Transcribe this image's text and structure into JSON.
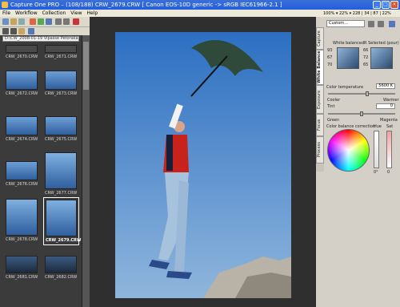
{
  "window": {
    "title": "Capture One PRO  –  (108/188) CRW_2679.CRW  [ Canon EOS-10D generic -> sRGB IEC61966-2.1 ]"
  },
  "menu": [
    "File",
    "Workflow",
    "Collection",
    "View",
    "Help"
  ],
  "toolbar": {
    "zoom_value": "",
    "status_readout": "100% ▾ 22% ▾ 228 | 34 | 87 | 22%"
  },
  "browser": {
    "folder": "D:\\CW_2008-01-19 Vipasse Petoraka",
    "thumbnails": [
      {
        "label": "CRW_2670.CRW",
        "selected": false
      },
      {
        "label": "CRW_2671.CRW",
        "selected": false
      },
      {
        "label": "CRW_2672.CRW",
        "selected": false
      },
      {
        "label": "CRW_2673.CRW",
        "selected": false
      },
      {
        "label": "CRW_2674.CRW",
        "selected": false
      },
      {
        "label": "CRW_2675.CRW",
        "selected": false
      },
      {
        "label": "CRW_2676.CRW",
        "selected": false
      },
      {
        "label": "CRW_2677.CRW",
        "selected": false
      },
      {
        "label": "CRW_2678.CRW",
        "selected": false
      },
      {
        "label": "CRW_2679.CRW",
        "selected": true
      },
      {
        "label": "CRW_2681.CRW",
        "selected": false
      },
      {
        "label": "CRW_2682.CRW",
        "selected": false
      }
    ]
  },
  "tools": {
    "tabs": [
      "Capture",
      "White Balance",
      "Exposure",
      "Focus",
      "Process"
    ],
    "active_tab": "White Balance",
    "preset": "Custom...",
    "white_balanced_label": "White balanced",
    "selected_label": "R Selected (pour)",
    "wb_values": [
      "93",
      "67",
      "70"
    ],
    "sel_values": [
      "66",
      "72",
      "65"
    ],
    "color_temperature_label": "Color temperature",
    "color_temperature_value": "5600 K",
    "cooler_label": "Cooler",
    "warmer_label": "Warmer",
    "tint_label": "Tint",
    "tint_value": "0",
    "green_label": "Green",
    "magenta_label": "Magenta",
    "color_balance_label": "Color balance correction",
    "hue_label": "Hue",
    "sat_label": "Sat",
    "hue_value": "0°",
    "sat_value": "0"
  },
  "colors": {
    "titlebar": "#245edb",
    "panel": "#3b3b3b",
    "selection": "#ffffff",
    "sky": "#2e6fbf"
  }
}
